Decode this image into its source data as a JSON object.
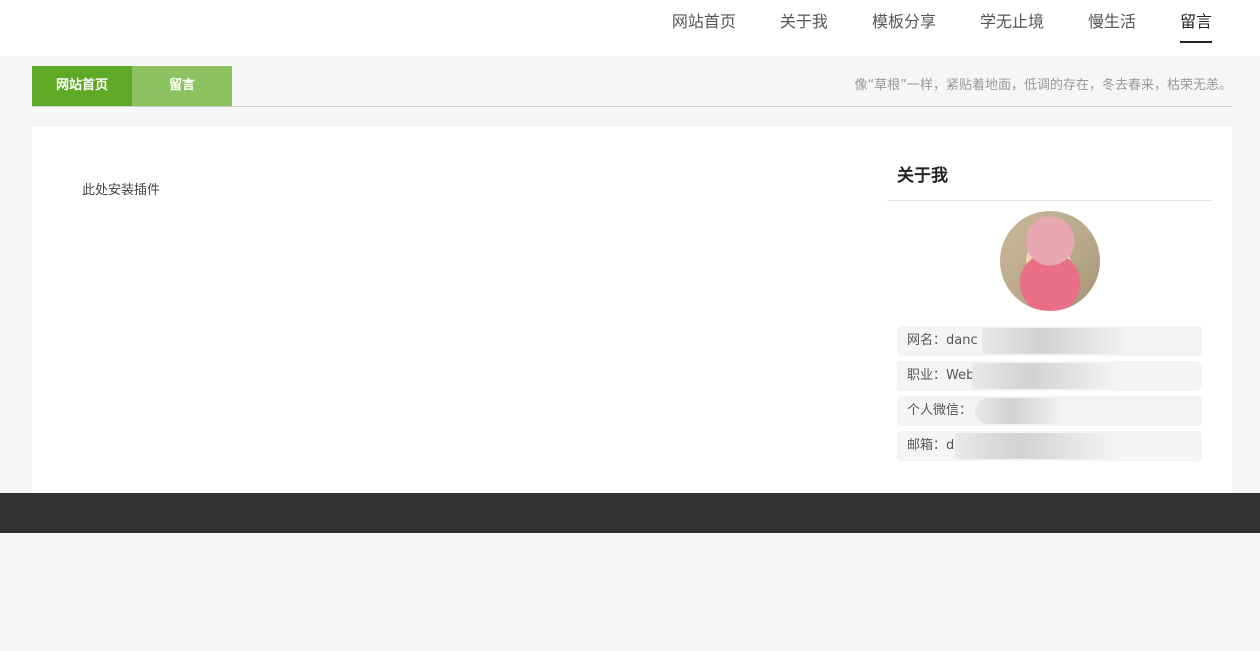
{
  "nav": {
    "items": [
      {
        "label": "网站首页"
      },
      {
        "label": "关于我"
      },
      {
        "label": "模板分享"
      },
      {
        "label": "学无止境"
      },
      {
        "label": "慢生活"
      },
      {
        "label": "留言"
      }
    ]
  },
  "breadcrumb": {
    "home": "网站首页",
    "current": "留言"
  },
  "motto": "像“草根”一样，紧贴着地面，低调的存在，冬去春来，枯荣无恙。",
  "main": {
    "plugin_placeholder": "此处安装插件"
  },
  "about": {
    "title": "关于我",
    "info": [
      {
        "text": "网名：danc"
      },
      {
        "text": "职业：Web"
      },
      {
        "text": "个人微信："
      },
      {
        "text": "邮箱：d"
      }
    ]
  },
  "colors": {
    "brand_green": "#5ea925",
    "light_green": "#8cc25f",
    "footer": "#333333"
  }
}
